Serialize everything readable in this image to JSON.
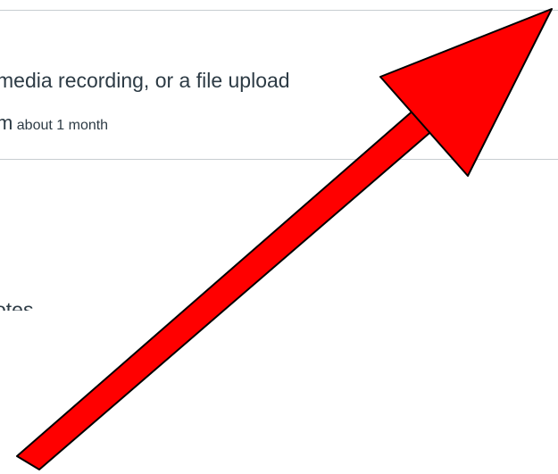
{
  "assignment": {
    "submission_types": "media recording, or a file upload",
    "meta_strong": "m",
    "meta_small": "about 1 month"
  },
  "partial_text": {
    "cut_line": "otes"
  },
  "annotation": {
    "arrow_color": "#ff0000",
    "arrow_outline": "#000000",
    "arrow_icon": "arrow-up-right-icon"
  }
}
